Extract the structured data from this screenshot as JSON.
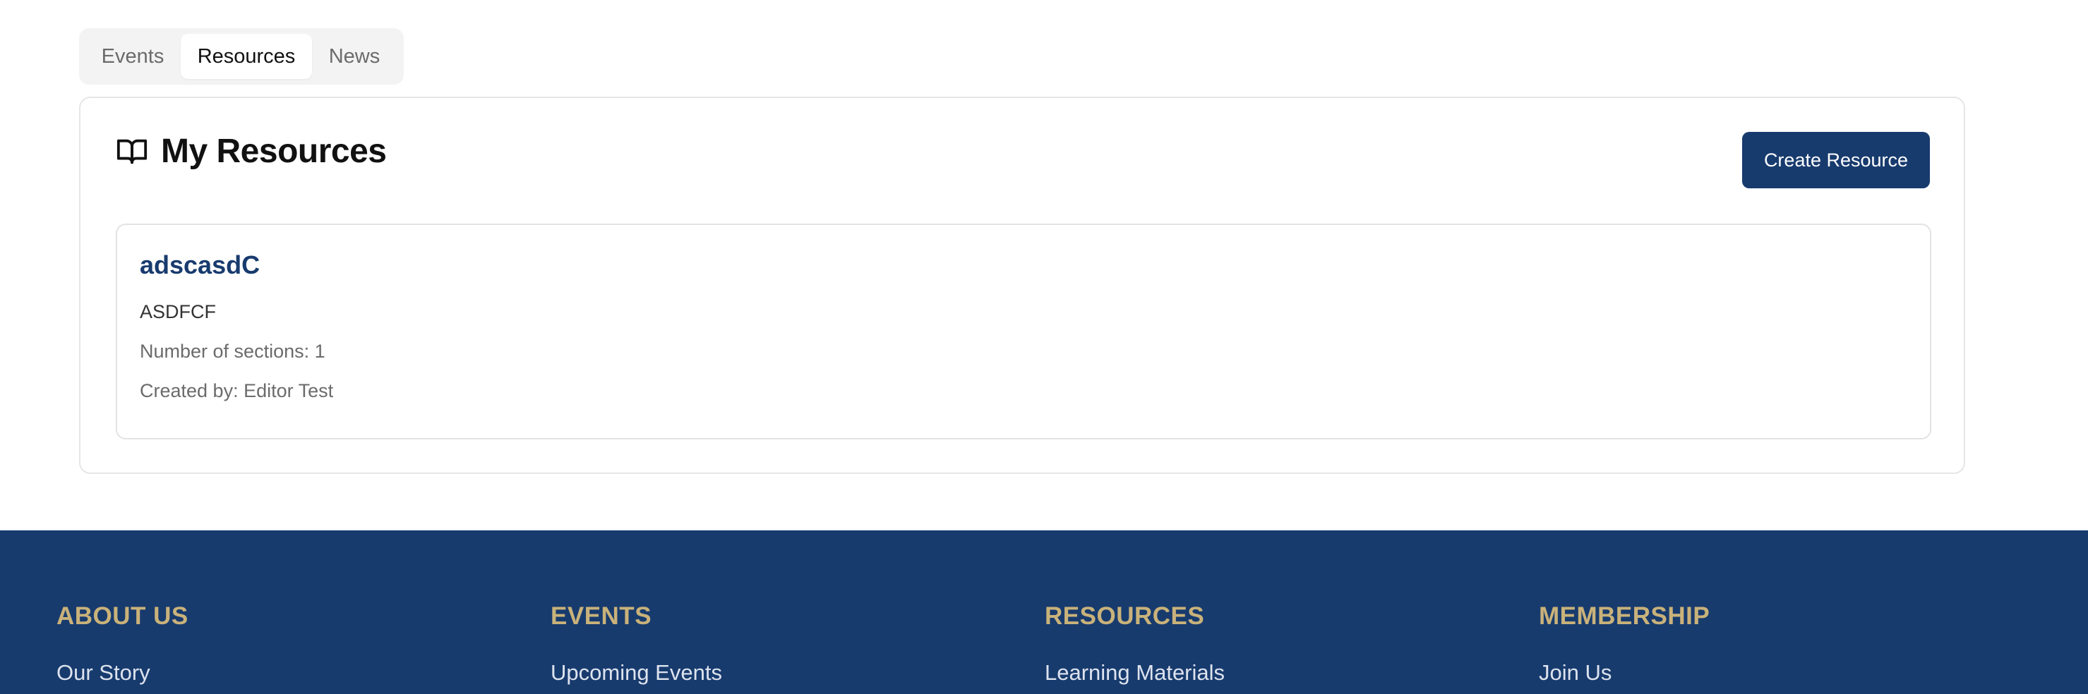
{
  "tabs": [
    {
      "label": "Events"
    },
    {
      "label": "Resources"
    },
    {
      "label": "News"
    }
  ],
  "active_tab": "Resources",
  "panel": {
    "title": "My Resources",
    "title_icon": "book-open-icon",
    "create_button_label": "Create Resource"
  },
  "resources": [
    {
      "title": "adscasdC",
      "description": "ASDFCF",
      "sections": "Number of sections: 1",
      "created_by": "Created by: Editor Test"
    }
  ],
  "footer": {
    "columns": [
      {
        "heading": "ABOUT US",
        "link": "Our Story"
      },
      {
        "heading": "EVENTS",
        "link": "Upcoming Events"
      },
      {
        "heading": "RESOURCES",
        "link": "Learning Materials"
      },
      {
        "heading": "MEMBERSHIP",
        "link": "Join Us"
      }
    ]
  },
  "colors": {
    "primary": "#183b6e",
    "footer_heading": "#c9b27a",
    "tab_bg": "#f3f3f3"
  }
}
